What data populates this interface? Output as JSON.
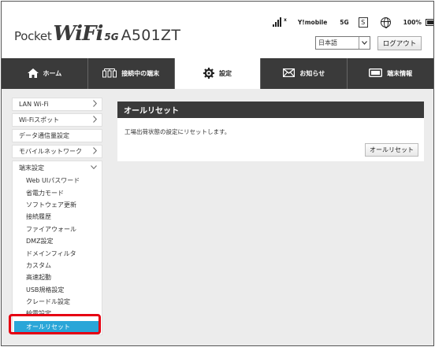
{
  "brand": {
    "part1": "Pocket",
    "part2": "WiFi",
    "part3": "5G",
    "model": "A501ZT"
  },
  "status": {
    "signal_symbol": "x",
    "carrier": "Y!mobile",
    "network": "5G",
    "sim_indicator": "S",
    "battery_percent": "100%",
    "battery_level": 1.0
  },
  "language": {
    "selected": "日本語"
  },
  "logout_label": "ログアウト",
  "nav": {
    "home": "ホーム",
    "devices": "接続中の端末",
    "settings": "設定",
    "notices": "お知らせ",
    "device_info": "端末情報"
  },
  "sidebar": {
    "items": [
      {
        "label": "LAN Wi-Fi",
        "has_chevron": true
      },
      {
        "label": "Wi-Fiスポット",
        "has_chevron": true
      },
      {
        "label": "データ通信量設定",
        "has_chevron": false
      },
      {
        "label": "モバイルネットワーク",
        "has_chevron": true
      }
    ],
    "group": {
      "title": "端末設定",
      "subitems": [
        "Web UIパスワード",
        "省電力モード",
        "ソフトウェア更新",
        "接続履歴",
        "ファイアウォール",
        "DMZ設定",
        "ドメインフィルタ",
        "カスタム",
        "高速起動",
        "USB規格設定",
        "クレードル設定",
        "給電設定",
        "オールリセット"
      ]
    }
  },
  "panel": {
    "title": "オールリセット",
    "description": "工場出荷状態の設定にリセットします。",
    "button_label": "オールリセット"
  }
}
